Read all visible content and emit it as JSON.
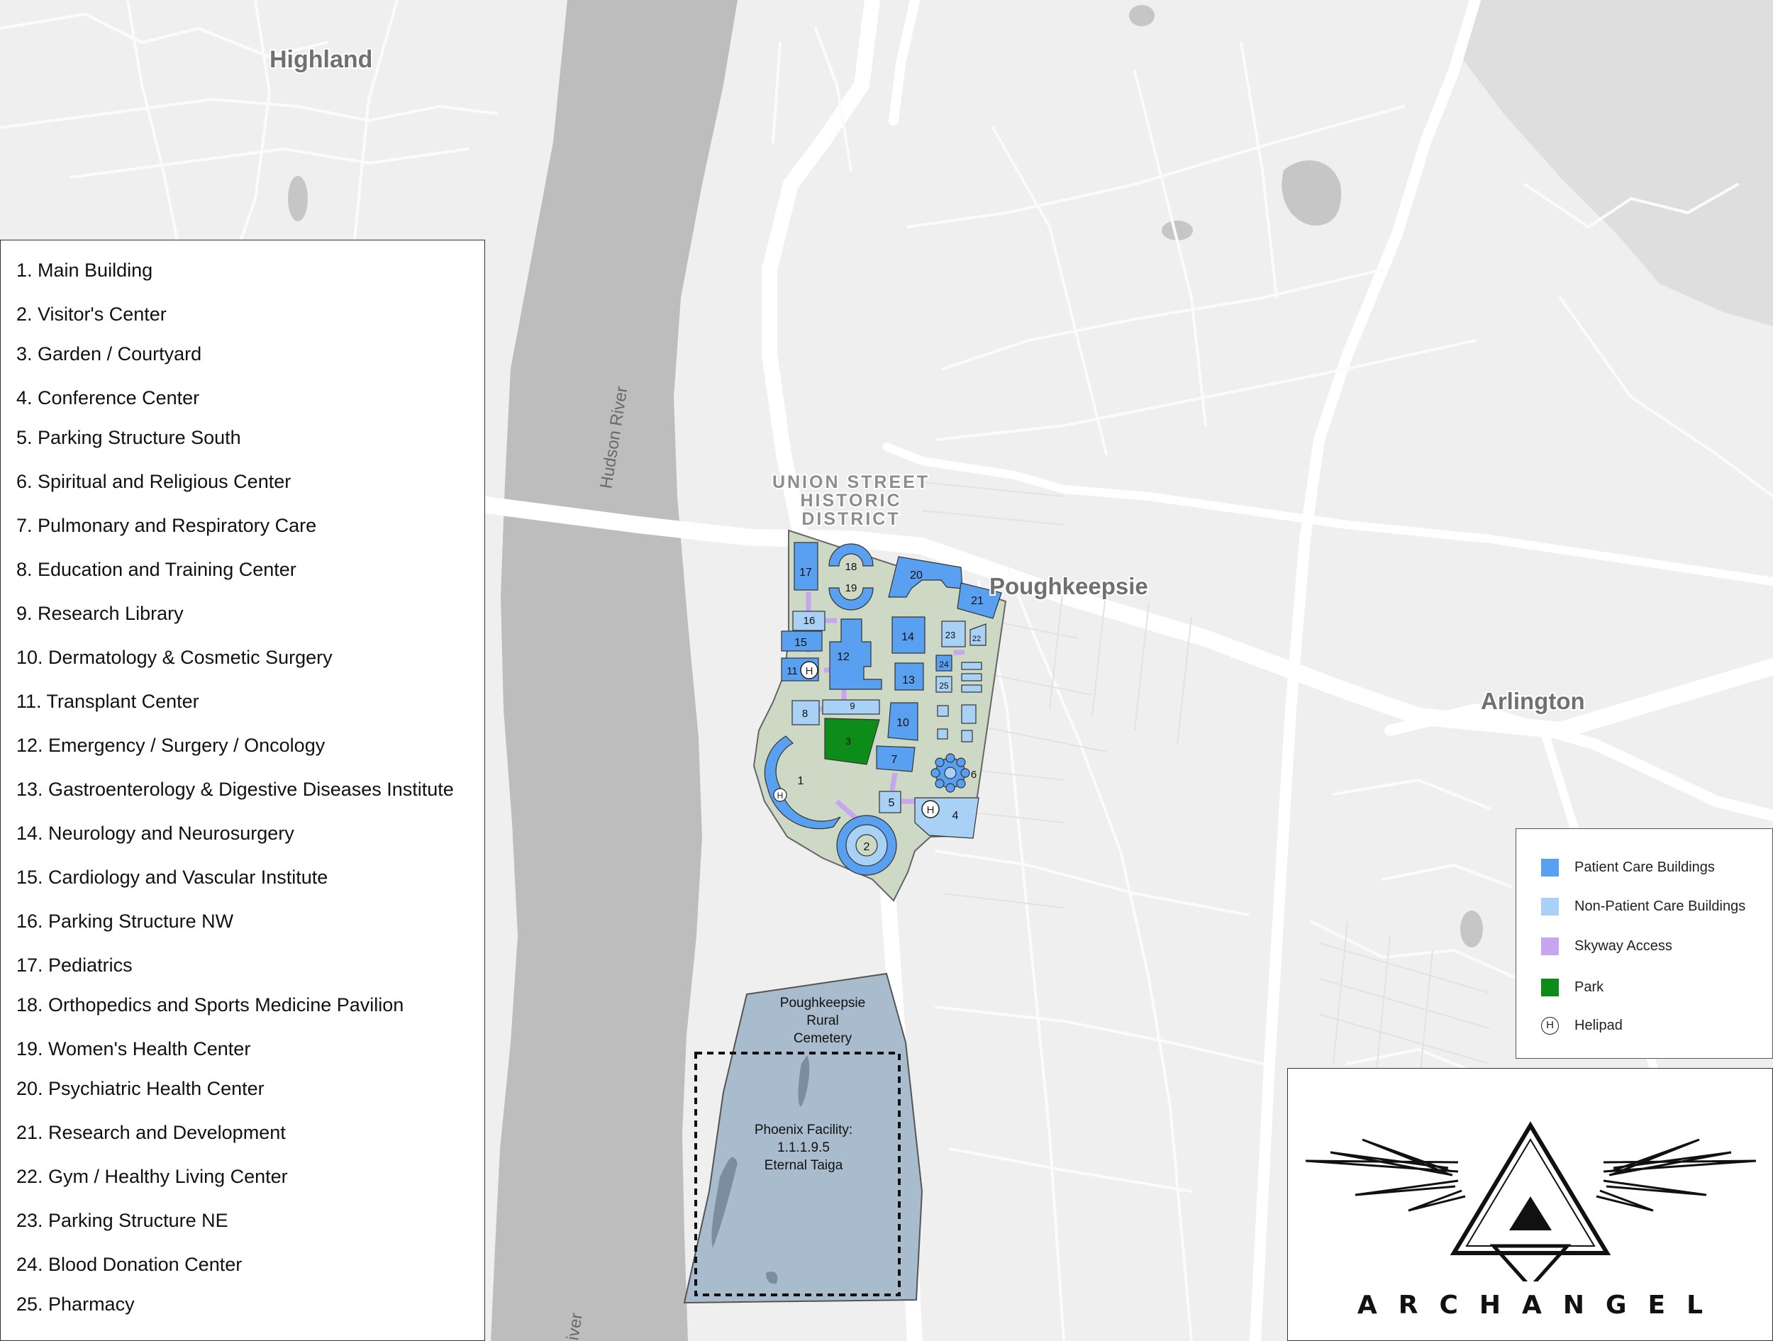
{
  "map": {
    "town_labels": {
      "highland": "Highland",
      "poughkeepsie": "Poughkeepsie",
      "arlington": "Arlington"
    },
    "district_label": [
      "UNION STREET",
      "HISTORIC",
      "DISTRICT"
    ],
    "river_label": "Hudson River",
    "river_label_bottom": "iver",
    "cemetery_label": [
      "Poughkeepsie",
      "Rural",
      "Cemetery"
    ],
    "facility_label": [
      "Phoenix Facility:",
      "1.1.1.9.5",
      "Eternal Taiga"
    ],
    "building_numbers": [
      "1",
      "2",
      "3",
      "4",
      "5",
      "6",
      "7",
      "8",
      "9",
      "10",
      "11",
      "12",
      "13",
      "14",
      "15",
      "16",
      "17",
      "18",
      "19",
      "20",
      "21",
      "22",
      "23",
      "24",
      "25"
    ],
    "helipad_symbol": "H"
  },
  "key": {
    "items": [
      "1. Main Building",
      "2. Visitor's Center",
      "3. Garden / Courtyard",
      "4. Conference Center",
      "5. Parking Structure South",
      "6. Spiritual and Religious Center",
      "7. Pulmonary and Respiratory Care",
      "8. Education and Training Center",
      "9. Research Library",
      "10. Dermatology & Cosmetic Surgery",
      "11. Transplant Center",
      "12. Emergency / Surgery / Oncology",
      "13. Gastroenterology & Digestive Diseases Institute",
      "14. Neurology and Neurosurgery",
      "15. Cardiology and Vascular Institute",
      "16. Parking Structure NW",
      "17. Pediatrics",
      "18. Orthopedics and Sports Medicine Pavilion",
      "19. Women's Health Center",
      "20. Psychiatric Health Center",
      "21. Research and Development",
      "22. Gym / Healthy Living Center",
      "23. Parking Structure NE",
      "24. Blood Donation Center",
      "25. Pharmacy"
    ]
  },
  "legend": {
    "patient_care": "Patient Care Buildings",
    "non_patient_care": "Non-Patient Care Buildings",
    "skyway": "Skyway Access",
    "park": "Park",
    "helipad": "Helipad"
  },
  "colors": {
    "patient_care": "#5aa0f0",
    "non_patient_care": "#a9d0f5",
    "skyway": "#c7a6f0",
    "park": "#0e8c1a",
    "campus": "#cdd9c4",
    "cemetery": "#a8bccd",
    "river": "#bdbdbd"
  },
  "logo": {
    "text": "ARCHANGEL"
  }
}
